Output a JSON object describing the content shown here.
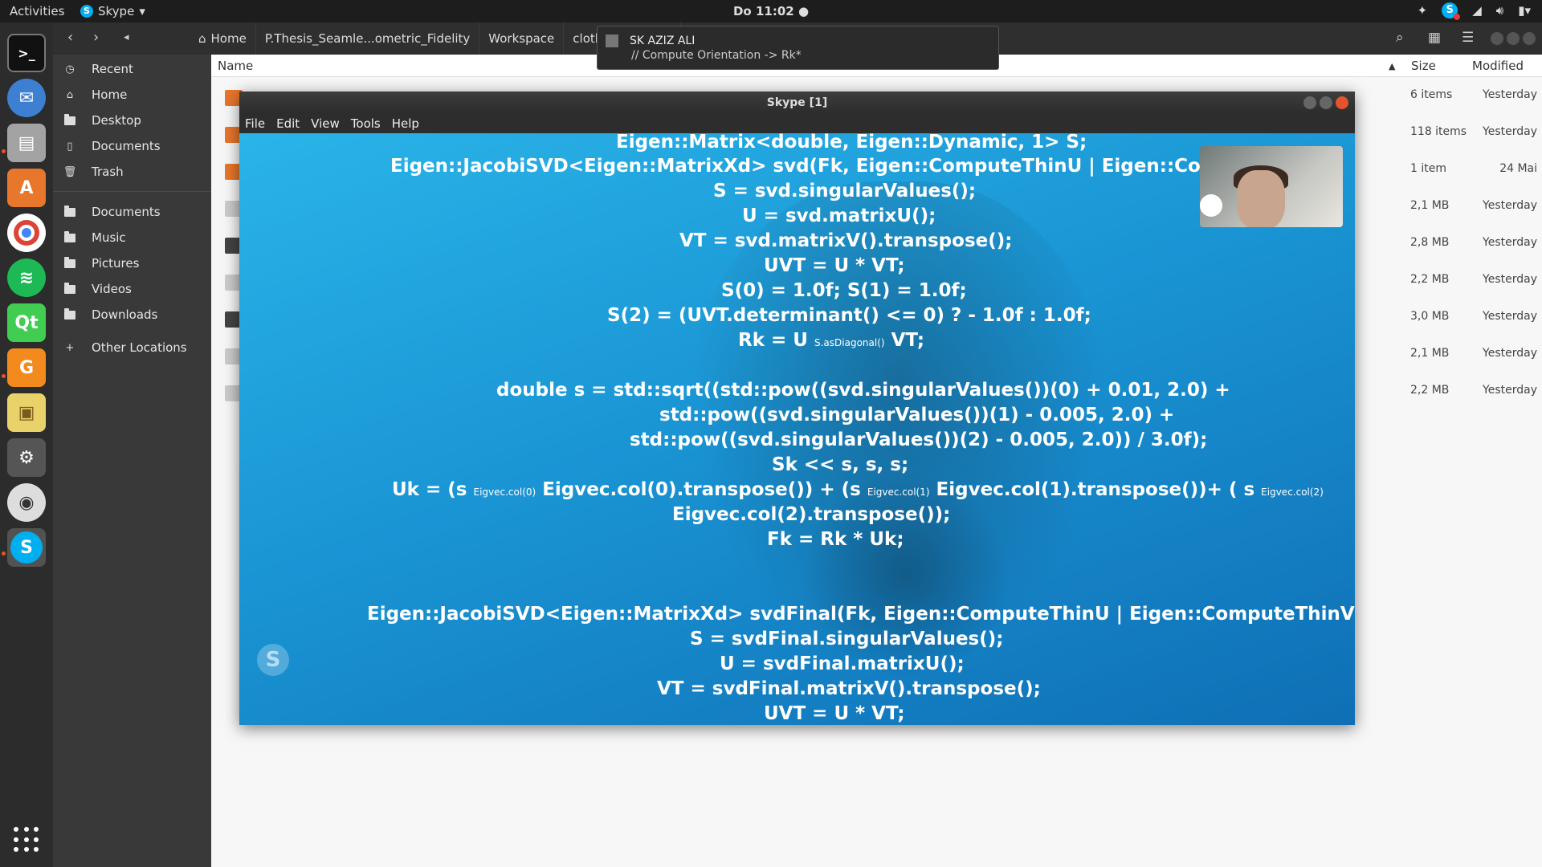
{
  "topbar": {
    "activities": "Activities",
    "app_name": "Skype",
    "clock": "Do 11:02"
  },
  "dock": {
    "apps": [
      "terminal-icon",
      "thunderbird-icon",
      "files-icon",
      "software-center-icon",
      "chrome-icon",
      "spotify-icon",
      "qt-creator-icon",
      "pdf-editor-icon",
      "image-viewer-icon",
      "settings-tools-icon",
      "eye-of-gnome-icon",
      "skype-icon"
    ]
  },
  "filemanager": {
    "breadcrumbs": [
      "Home",
      "P.Thesis_Seamle...ometric_Fidelity",
      "Workspace",
      "cloth_simulation"
    ],
    "sidebar": [
      {
        "label": "Recent",
        "icon": "clock-icon"
      },
      {
        "label": "Home",
        "icon": "home-icon"
      },
      {
        "label": "Desktop",
        "icon": "folder-icon"
      },
      {
        "label": "Documents",
        "icon": "document-icon"
      },
      {
        "label": "Trash",
        "icon": "trash-icon"
      },
      {
        "label": "Documents",
        "icon": "folder-icon"
      },
      {
        "label": "Music",
        "icon": "folder-icon"
      },
      {
        "label": "Pictures",
        "icon": "folder-icon"
      },
      {
        "label": "Videos",
        "icon": "folder-icon"
      },
      {
        "label": "Downloads",
        "icon": "folder-icon"
      },
      {
        "label": "Other Locations",
        "icon": "plus-icon"
      }
    ],
    "columns": {
      "name": "Name",
      "size": "Size",
      "modified": "Modified"
    },
    "rows": [
      {
        "size": "6 items",
        "modified": "Yesterday"
      },
      {
        "size": "118 items",
        "modified": "Yesterday"
      },
      {
        "size": "1 item",
        "modified": "24 Mai"
      },
      {
        "size": "2,1 MB",
        "modified": "Yesterday"
      },
      {
        "size": "2,8 MB",
        "modified": "Yesterday"
      },
      {
        "size": "2,2 MB",
        "modified": "Yesterday"
      },
      {
        "size": "3,0 MB",
        "modified": "Yesterday"
      },
      {
        "size": "2,1 MB",
        "modified": "Yesterday"
      },
      {
        "size": "2,2 MB",
        "modified": "Yesterday"
      }
    ]
  },
  "notification": {
    "sender": "SK AZIZ ALI",
    "message": "// Compute Orientation -> Rk*"
  },
  "skype": {
    "title": "Skype [1]",
    "menu": [
      "File",
      "Edit",
      "View",
      "Tools",
      "Help"
    ],
    "code_lines": [
      "Eigen::Matrix<double, Eigen::Dynamic, 1> S;",
      "Eigen::JacobiSVD<Eigen::MatrixXd> svd(Fk, Eigen::ComputeThinU | Eigen::Compute",
      "S = svd.singularValues();",
      "U = svd.matrixU();",
      "VT = svd.matrixV().transpose();",
      "UVT = U * VT;",
      "S(0) = 1.0f; S(1) = 1.0f;",
      "S(2) = (UVT.determinant() <= 0) ? - 1.0f : 1.0f;",
      "Rk = U",
      "S.asDiagonal()",
      "VT;",
      "double s = std::sqrt((std::pow((svd.singularValues())(0) + 0.01, 2.0) +",
      "std::pow((svd.singularValues())(1) - 0.005, 2.0) +",
      "std::pow((svd.singularValues())(2) - 0.005, 2.0)) / 3.0f);",
      "Sk << s, s, s;",
      "Uk = (s",
      "Eigvec.col(0)",
      "Eigvec.col(0).transpose()) + (s",
      "Eigvec.col(1)",
      "Eigvec.col(1).transpose())+ ( s",
      "Eigvec.col(2)",
      "Eigvec.col(2).transpose());",
      "Fk = Rk * Uk;",
      "Eigen::JacobiSVD<Eigen::MatrixXd> svdFinal(Fk, Eigen::ComputeThinU | Eigen::ComputeThinV);",
      "S = svdFinal.singularValues();",
      "U = svdFinal.matrixU();",
      "VT = svdFinal.matrixV().transpose();",
      "UVT = U * VT;"
    ]
  },
  "colors": {
    "skype_blue": "#00aff0",
    "ubuntu_orange": "#e95420",
    "close_red": "#e5532d"
  }
}
